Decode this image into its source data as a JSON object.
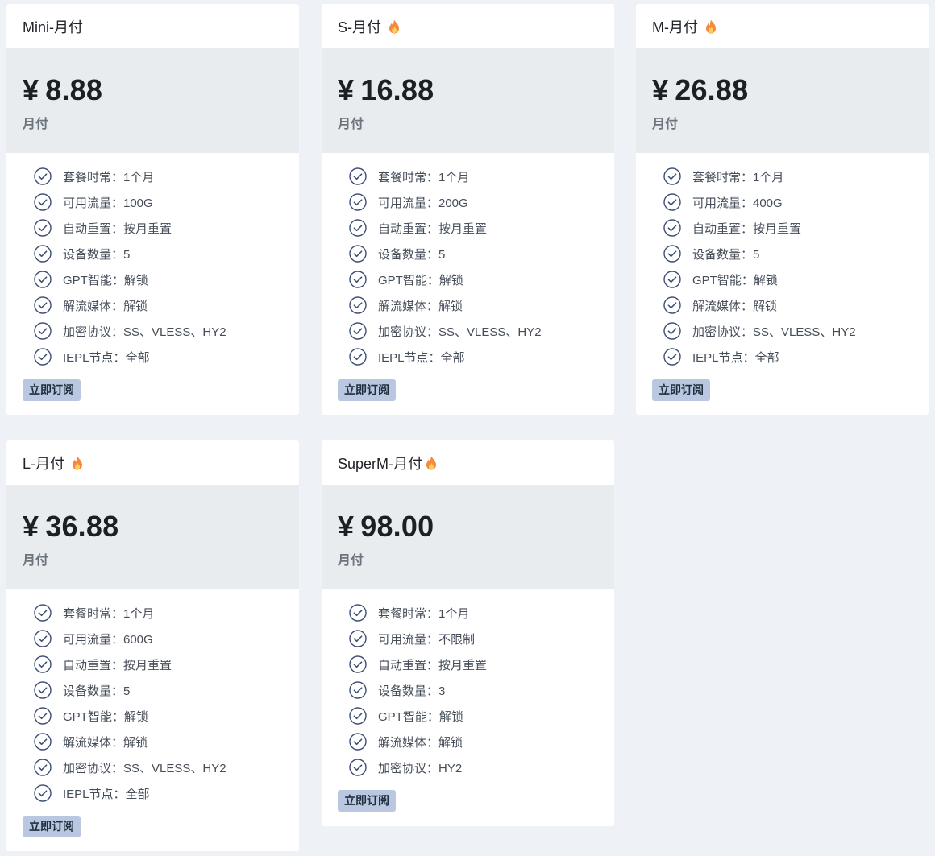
{
  "plans": [
    {
      "name": "Mini-月付",
      "hot": false,
      "currency": "¥",
      "price": "8.88",
      "period": "月付",
      "features": [
        "套餐时常：1个月",
        "可用流量：100G",
        "自动重置：按月重置",
        "设备数量：5",
        "GPT智能：解锁",
        "解流媒体：解锁",
        "加密协议：SS、VLESS、HY2",
        "IEPL节点：全部"
      ],
      "button": "立即订阅"
    },
    {
      "name": "S-月付",
      "hot": true,
      "currency": "¥",
      "price": "16.88",
      "period": "月付",
      "features": [
        "套餐时常：1个月",
        "可用流量：200G",
        "自动重置：按月重置",
        "设备数量：5",
        "GPT智能：解锁",
        "解流媒体：解锁",
        "加密协议：SS、VLESS、HY2",
        "IEPL节点：全部"
      ],
      "button": "立即订阅"
    },
    {
      "name": "M-月付",
      "hot": true,
      "currency": "¥",
      "price": "26.88",
      "period": "月付",
      "features": [
        "套餐时常：1个月",
        "可用流量：400G",
        "自动重置：按月重置",
        "设备数量：5",
        "GPT智能：解锁",
        "解流媒体：解锁",
        "加密协议：SS、VLESS、HY2",
        "IEPL节点：全部"
      ],
      "button": "立即订阅"
    },
    {
      "name": "L-月付",
      "hot": true,
      "currency": "¥",
      "price": "36.88",
      "period": "月付",
      "features": [
        "套餐时常：1个月",
        "可用流量：600G",
        "自动重置：按月重置",
        "设备数量：5",
        "GPT智能：解锁",
        "解流媒体：解锁",
        "加密协议：SS、VLESS、HY2",
        "IEPL节点：全部"
      ],
      "button": "立即订阅"
    },
    {
      "name": "SuperM-月付",
      "hot": true,
      "currency": "¥",
      "price": "98.00",
      "period": "月付",
      "features": [
        "套餐时常：1个月",
        "可用流量：不限制",
        "自动重置：按月重置",
        "设备数量：3",
        "GPT智能：解锁",
        "解流媒体：解锁",
        "加密协议：HY2"
      ],
      "button": "立即订阅"
    }
  ],
  "colors": {
    "background": "#eef1f6",
    "price_block": "#e9ecef",
    "button": "#b9c7e0",
    "check_icon": "#3d4e74",
    "fire_outer": "#f5883a",
    "fire_inner": "#fbd260"
  },
  "icons": {
    "feature": "check-circle-icon",
    "hot": "fire-icon"
  }
}
